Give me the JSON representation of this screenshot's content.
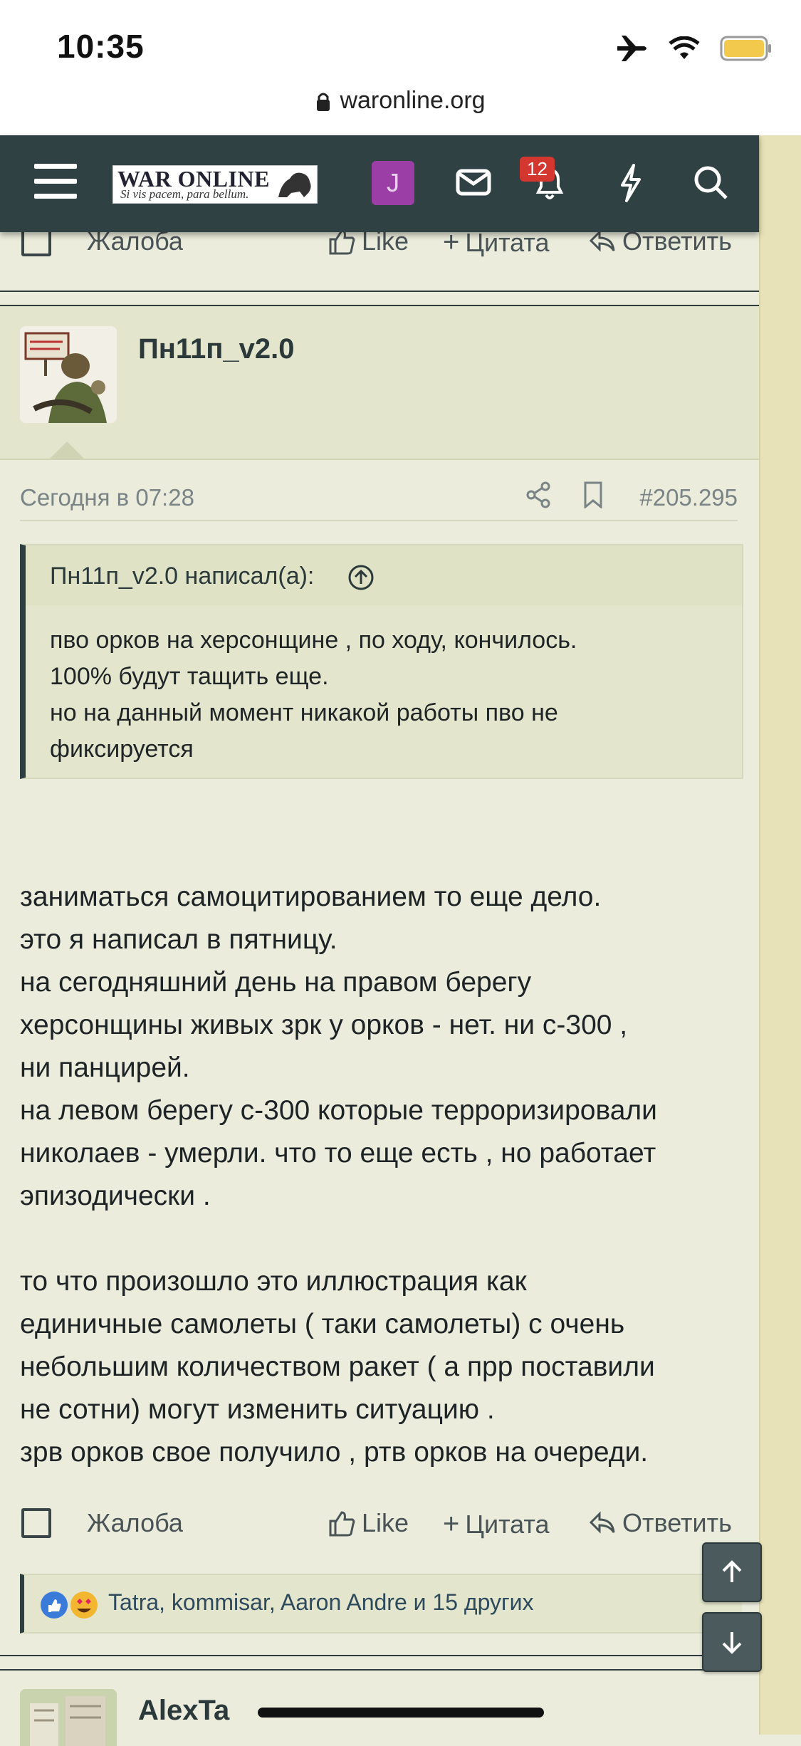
{
  "status": {
    "time": "10:35"
  },
  "browser": {
    "url": "waronline.org"
  },
  "nav": {
    "logo_title": "WAR ONLINE",
    "logo_tagline": "Si vis pacem, para bellum.",
    "user_initial": "J",
    "notifications_count": "12"
  },
  "actions": {
    "report": "Жалоба",
    "like": "Like",
    "quote": "Цитата",
    "reply": "Ответить"
  },
  "post": {
    "username": "Пн11п_v2.0",
    "date": "Сегодня в 07:28",
    "number": "#205.295",
    "quote": {
      "author": "Пн11п_v2.0 написал(а):",
      "lines": [
        "пво орков на херсонщине , по ходу, кончилось.",
        "100% будут тащить еще.",
        "но на данный момент никакой работы пво не",
        "фиксируется"
      ]
    },
    "message_lines": [
      "заниматься самоцитированием то еще дело.",
      "это я написал в пятницу.",
      "на сегодняшний день на правом берегу",
      "херсонщины живых зрк у орков - нет. ни с-300 ,",
      "ни панцирей.",
      "на левом берегу с-300 которые терроризировали",
      "николаев - умерли. что то еще есть , но работает",
      "эпизодически .",
      "",
      "то что произошло это иллюстрация как",
      "единичные самолеты ( таки самолеты) с очень",
      "небольшим количеством ракет ( а прр поставили",
      "не сотни) могут изменить ситуацию .",
      "зрв орков свое получило , ртв орков на очереди."
    ],
    "reactions": "Tatra, kommisar, Aaron Andre и 15 других"
  },
  "next_post": {
    "username": "AlexTa"
  },
  "colors": {
    "nav_bg": "#304143",
    "page_bg": "#ebecdc",
    "badge": "#d4372f",
    "accent_purple": "#9b3fa7"
  }
}
